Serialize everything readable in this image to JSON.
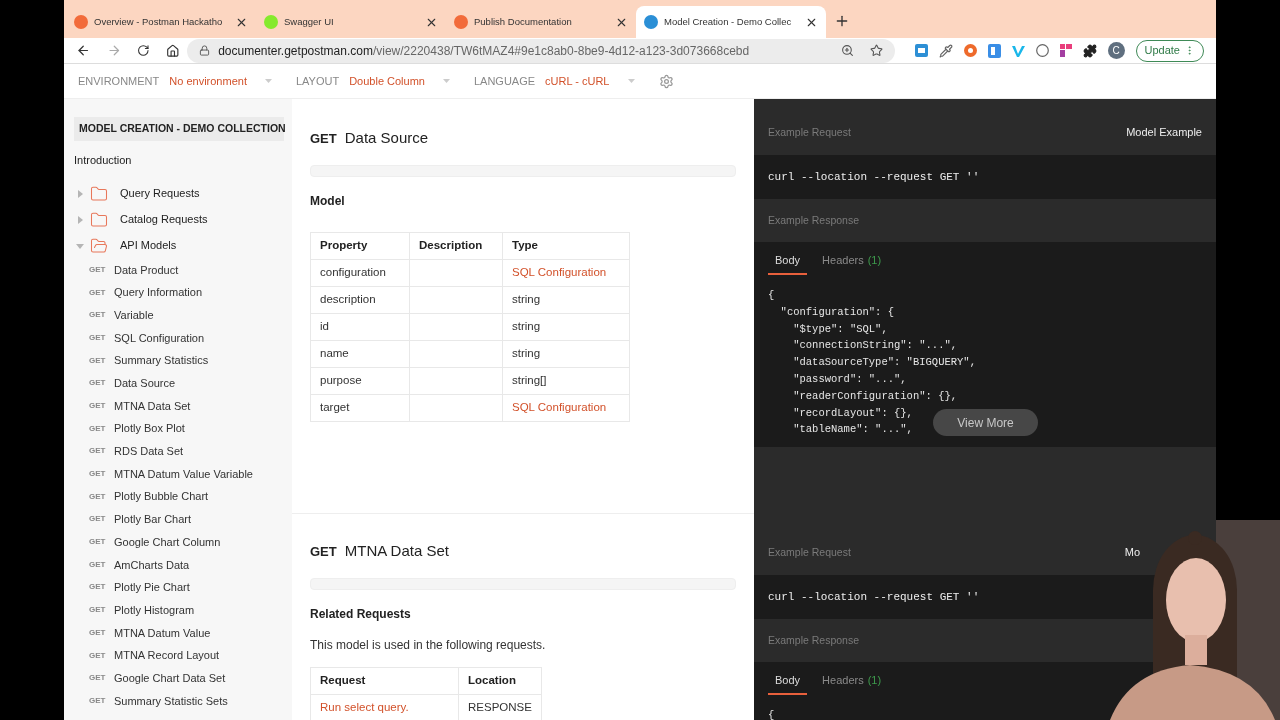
{
  "browser": {
    "tabs": [
      {
        "title": "Overview - Postman Hackatho",
        "selected": false,
        "color": "#f26b3a"
      },
      {
        "title": "Swagger UI",
        "selected": false,
        "color": "#85ea2d"
      },
      {
        "title": "Publish Documentation",
        "selected": false,
        "color": "#f26b3a"
      },
      {
        "title": "Model Creation - Demo Collec",
        "selected": true,
        "color": "#2b8fd6"
      }
    ],
    "url_host": "documenter.getpostman.com",
    "url_path": "/view/2220438/TW6tMAZ4#9e1c8ab0-8be9-4d12-a123-3d073668cebd",
    "profile": "C",
    "update_button": "Update"
  },
  "doc_toolbar": [
    {
      "label": "ENVIRONMENT",
      "value": "No environment"
    },
    {
      "label": "LAYOUT",
      "value": "Double Column"
    },
    {
      "label": "LANGUAGE",
      "value": "cURL - cURL"
    }
  ],
  "sidebar": {
    "collection_title": "MODEL CREATION - DEMO COLLECTION",
    "introduction": "Introduction",
    "folders": [
      {
        "name": "Query Requests",
        "expanded": false
      },
      {
        "name": "Catalog Requests",
        "expanded": false
      },
      {
        "name": "API Models",
        "expanded": true,
        "children": [
          {
            "method": "GET",
            "name": "Data Product"
          },
          {
            "method": "GET",
            "name": "Query Information"
          },
          {
            "method": "GET",
            "name": "Variable"
          },
          {
            "method": "GET",
            "name": "SQL Configuration"
          },
          {
            "method": "GET",
            "name": "Summary Statistics"
          },
          {
            "method": "GET",
            "name": "Data Source"
          },
          {
            "method": "GET",
            "name": "MTNA Data Set"
          },
          {
            "method": "GET",
            "name": "Plotly Box Plot"
          },
          {
            "method": "GET",
            "name": "RDS Data Set"
          },
          {
            "method": "GET",
            "name": "MTNA Datum Value Variable"
          },
          {
            "method": "GET",
            "name": "Plotly Bubble Chart"
          },
          {
            "method": "GET",
            "name": "Plotly Bar Chart"
          },
          {
            "method": "GET",
            "name": "Google Chart Column"
          },
          {
            "method": "GET",
            "name": "AmCharts Data"
          },
          {
            "method": "GET",
            "name": "Plotly Pie Chart"
          },
          {
            "method": "GET",
            "name": "Plotly Histogram"
          },
          {
            "method": "GET",
            "name": "MTNA Datum Value"
          },
          {
            "method": "GET",
            "name": "MTNA Record Layout"
          },
          {
            "method": "GET",
            "name": "Google Chart Data Set"
          },
          {
            "method": "GET",
            "name": "Summary Statistic Sets"
          }
        ]
      }
    ]
  },
  "sections": [
    {
      "method": "GET",
      "title": "Data Source",
      "heading": "Model",
      "table": {
        "columns": [
          "Property",
          "Description",
          "Type"
        ],
        "rows": [
          [
            {
              "text": "configuration",
              "link": false
            },
            null,
            {
              "text": "SQL Configuration",
              "link": true
            }
          ],
          [
            {
              "text": "description",
              "link": false
            },
            null,
            {
              "text": "string",
              "link": false
            }
          ],
          [
            {
              "text": "id",
              "link": false
            },
            null,
            {
              "text": "string",
              "link": false
            }
          ],
          [
            {
              "text": "name",
              "link": false
            },
            null,
            {
              "text": "string",
              "link": false
            }
          ],
          [
            {
              "text": "purpose",
              "link": false
            },
            null,
            {
              "text": "string[]",
              "link": false
            }
          ],
          [
            {
              "text": "target",
              "link": false
            },
            null,
            {
              "text": "SQL Configuration",
              "link": true
            }
          ]
        ]
      }
    },
    {
      "method": "GET",
      "title": "MTNA Data Set",
      "heading": "Related Requests",
      "text": "This model is used in the following requests.",
      "table": {
        "columns": [
          "Request",
          "Location"
        ],
        "rows": [
          [
            {
              "text": "Run select query.",
              "link": true
            },
            {
              "text": "RESPONSE",
              "link": false
            }
          ]
        ]
      }
    }
  ],
  "examples": [
    {
      "request_label": "Example Request",
      "model_label": "Model Example",
      "code": "curl --location --request GET ''",
      "response_label": "Example Response",
      "tabs": [
        {
          "label": "Body",
          "selected": true
        },
        {
          "label": "Headers",
          "count": "(1)",
          "selected": false
        }
      ],
      "body_lines": [
        "{",
        "  \"configuration\": {",
        "    \"$type\": \"SQL\",",
        "    \"connectionString\": \"...\",",
        "    \"dataSourceType\": \"BIGQUERY\",",
        "    \"password\": \"...\",",
        "    \"readerConfiguration\": {},",
        "    \"recordLayout\": {},",
        "    \"tableName\": \"...\","
      ],
      "view_more": "View More"
    },
    {
      "request_label": "Example Request",
      "model_label": "Mo",
      "code": "curl --location --request GET ''",
      "response_label": "Example Response",
      "tabs": [
        {
          "label": "Body",
          "selected": true
        },
        {
          "label": "Headers",
          "count": "(1)",
          "selected": false
        }
      ],
      "body_lines": [
        "{"
      ]
    }
  ]
}
